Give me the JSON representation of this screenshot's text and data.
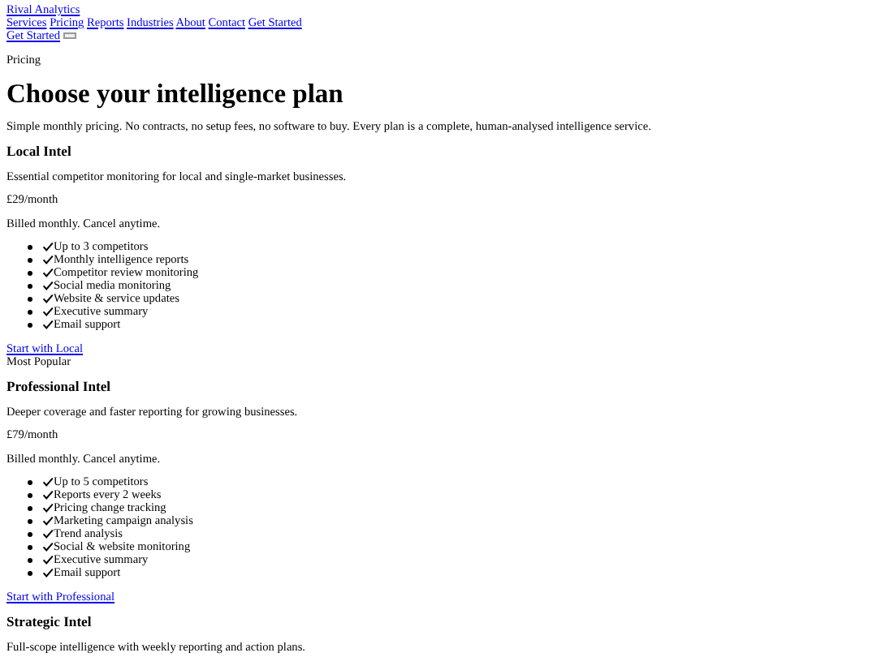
{
  "brand": "Rival Analytics",
  "nav": [
    "Services",
    "Pricing",
    "Reports",
    "Industries",
    "About",
    "Contact",
    "Get Started"
  ],
  "mobile_cta": "Get Started",
  "eyebrow": "Pricing",
  "title": "Choose your intelligence plan",
  "subtitle": "Simple monthly pricing. No contracts, no setup fees, no software to buy. Every plan is a complete, human-analysed intelligence service.",
  "plans": [
    {
      "name": "Local Intel",
      "description": "Essential competitor monitoring for local and single-market businesses.",
      "price": "£29/month",
      "billing": "Billed monthly. Cancel anytime.",
      "features": [
        "Up to 3 competitors",
        "Monthly intelligence reports",
        "Competitor review monitoring",
        "Social media monitoring",
        "Website & service updates",
        "Executive summary",
        "Email support"
      ],
      "cta": "Start with Local"
    },
    {
      "badge": "Most Popular",
      "name": "Professional Intel",
      "description": "Deeper coverage and faster reporting for growing businesses.",
      "price": "£79/month",
      "billing": "Billed monthly. Cancel anytime.",
      "features": [
        "Up to 5 competitors",
        "Reports every 2 weeks",
        "Pricing change tracking",
        "Marketing campaign analysis",
        "Trend analysis",
        "Social & website monitoring",
        "Executive summary",
        "Email support"
      ],
      "cta": "Start with Professional"
    },
    {
      "name": "Strategic Intel",
      "description": "Full-scope intelligence with weekly reporting and action plans."
    }
  ]
}
